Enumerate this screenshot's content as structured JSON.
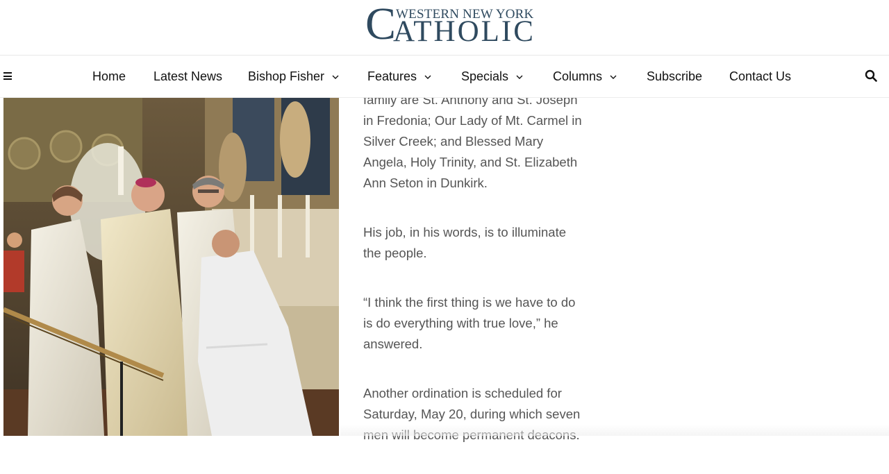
{
  "logo": {
    "top_line": "WESTERN NEW YORK",
    "initial": "C",
    "bottom_line": "ATHOLIC"
  },
  "nav": {
    "items": [
      {
        "label": "Home",
        "dropdown": false
      },
      {
        "label": "Latest News",
        "dropdown": false
      },
      {
        "label": "Bishop Fisher",
        "dropdown": true
      },
      {
        "label": "Features",
        "dropdown": true
      },
      {
        "label": "Specials",
        "dropdown": true
      },
      {
        "label": "Columns",
        "dropdown": true
      },
      {
        "label": "Subscribe",
        "dropdown": false
      },
      {
        "label": "Contact Us",
        "dropdown": false
      }
    ],
    "menu_icon": "hamburger-icon",
    "search_icon": "search-icon"
  },
  "article": {
    "paragraphs": [
      "family are St. Anthony and St. Joseph in Fredonia; Our Lady of Mt. Carmel in Silver Creek; and Blessed Mary Angela, Holy Trinity, and St. Elizabeth Ann Seton in Dunkirk.",
      "His job, in his words, is to illuminate the people.",
      "“I think the first thing is we have to do is do everything with true love,” he answered.",
      "Another ordination is scheduled for Saturday, May 20, during which seven men will become permanent deacons."
    ]
  },
  "colors": {
    "logo": "#2f4a5f",
    "nav_text": "#111111",
    "body_text": "#555555"
  }
}
